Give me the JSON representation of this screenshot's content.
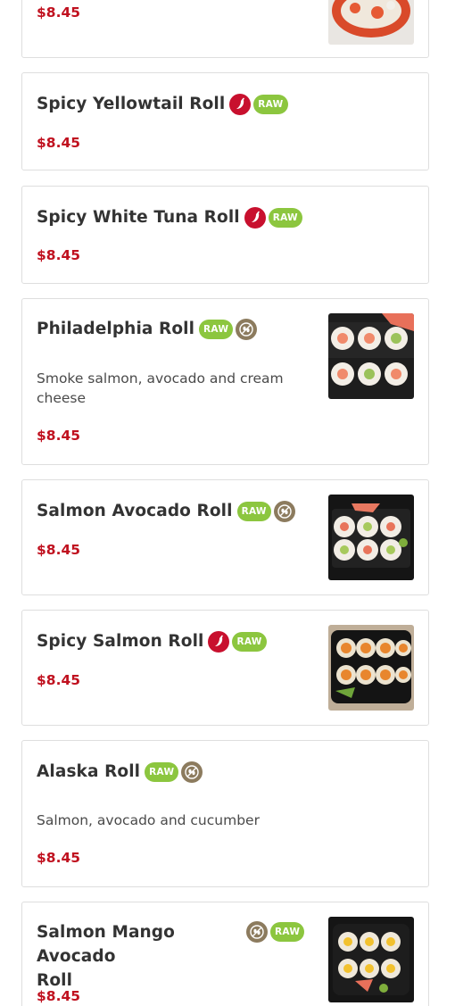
{
  "items": [
    {
      "name": "",
      "price": "$8.45",
      "description": "",
      "badges": [],
      "has_image": true
    },
    {
      "name": "Spicy Yellowtail Roll",
      "price": "$8.45",
      "description": "",
      "badges": [
        "spicy",
        "raw"
      ],
      "has_image": false
    },
    {
      "name": "Spicy White Tuna Roll",
      "price": "$8.45",
      "description": "",
      "badges": [
        "spicy",
        "raw"
      ],
      "has_image": false
    },
    {
      "name": "Philadelphia Roll",
      "price": "$8.45",
      "description": "Smoke salmon, avocado and cream cheese",
      "badges": [
        "raw",
        "gluten-free"
      ],
      "has_image": true
    },
    {
      "name": "Salmon Avocado Roll",
      "price": "$8.45",
      "description": "",
      "badges": [
        "raw",
        "gluten-free"
      ],
      "has_image": true
    },
    {
      "name": "Spicy Salmon Roll",
      "price": "$8.45",
      "description": "",
      "badges": [
        "spicy",
        "raw"
      ],
      "has_image": true
    },
    {
      "name": "Alaska Roll",
      "price": "$8.45",
      "description": "Salmon, avocado and cucumber",
      "badges": [
        "raw",
        "gluten-free"
      ],
      "has_image": false
    },
    {
      "name": "Salmon Mango Avocado Roll",
      "name_line1": "Salmon Mango Avocado",
      "name_line2": "Roll",
      "price": "$8.45",
      "description": "",
      "badges": [
        "gluten-free",
        "raw"
      ],
      "has_image": true
    }
  ],
  "badge_labels": {
    "raw": "RAW"
  },
  "icons": {
    "spicy": "chili-pepper-icon",
    "raw": "raw-badge",
    "gluten-free": "gluten-free-icon"
  },
  "colors": {
    "price": "#c0111f",
    "spicy": "#c8102e",
    "raw": "#8cc63f",
    "gluten_free": "#8c7b5e"
  }
}
